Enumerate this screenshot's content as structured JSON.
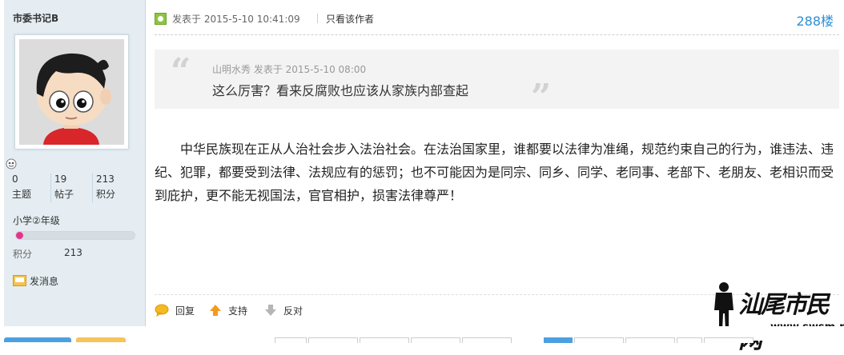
{
  "author": {
    "username": "市委书记B",
    "stats": [
      {
        "value": "0",
        "label": "主题"
      },
      {
        "value": "19",
        "label": "帖子"
      },
      {
        "value": "213",
        "label": "积分"
      }
    ],
    "level": "小学②年级",
    "level_progress": 0.06,
    "points_label": "积分",
    "points_value": "213",
    "send_message": "发消息"
  },
  "post": {
    "posted_at": "发表于 2015-5-10 10:41:09",
    "only_author": "只看该作者",
    "floor": "288楼",
    "quote": {
      "meta": "山明水秀 发表于 2015-5-10 08:00",
      "text": "这么厉害？看来反腐败也应该从家族内部查起"
    },
    "body": "中华民族现在正从人治社会步入法治社会。在法治国家里，谁都要以法律为准绳，规范约束自己的行为，谁违法、违纪、犯罪，都要受到法律、法规应有的惩罚；也不可能因为是同宗、同乡、同学、老同事、老部下、老朋友、老相识而受到庇护，更不能无视国法，官官相护，损害法律尊严！",
    "actions": {
      "reply": "回复",
      "support": "支持",
      "oppose": "反对"
    }
  },
  "watermark": {
    "text": "汕尾市民网",
    "url": "www.swsm.net"
  },
  "colors": {
    "sidebar_bg": "#e5edf2",
    "floor_link": "#2b8fd7",
    "online_icon": "#8cc63e",
    "level_bar_fill": "#e5338c"
  }
}
